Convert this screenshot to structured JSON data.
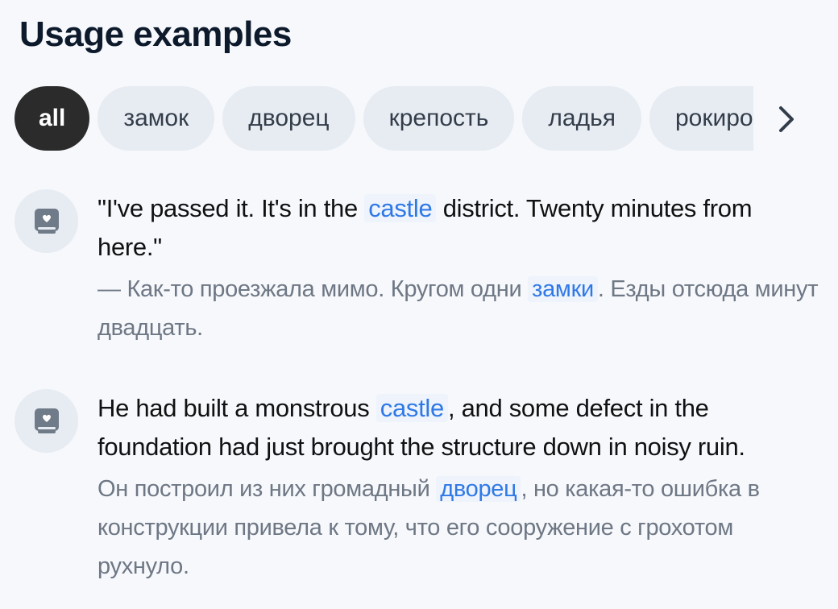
{
  "title": "Usage examples",
  "chips": [
    "all",
    "замок",
    "дворец",
    "крепость",
    "ладья",
    "рокировка"
  ],
  "active_chip": "all",
  "next_icon": "chevron-right-icon",
  "examples": [
    {
      "icon": "book-heart-icon",
      "source": {
        "before": "\"I've passed it. It's in the ",
        "highlight": "castle",
        "after": " district. Twenty minutes from here.\""
      },
      "translation": {
        "before": "— Как-то проезжала мимо. Кругом одни ",
        "highlight": "замки",
        "after": ". Езды отсюда минут двадцать."
      }
    },
    {
      "icon": "book-heart-icon",
      "source": {
        "before": "He had built a monstrous ",
        "highlight": "castle",
        "after": ", and some defect in the foundation had just brought the structure down in noisy ruin."
      },
      "translation": {
        "before": "Он построил из них громадный ",
        "highlight": "дворец",
        "after": ", но какая-то ошибка в конструкции привела к тому, что его сооружение с грохотом рухнуло."
      }
    }
  ],
  "colors": {
    "accent": "#2f79e6",
    "highlight_bg": "#eef3fc",
    "chip_bg": "#e7ebf2",
    "chip_active_bg": "#2b2b2b"
  }
}
